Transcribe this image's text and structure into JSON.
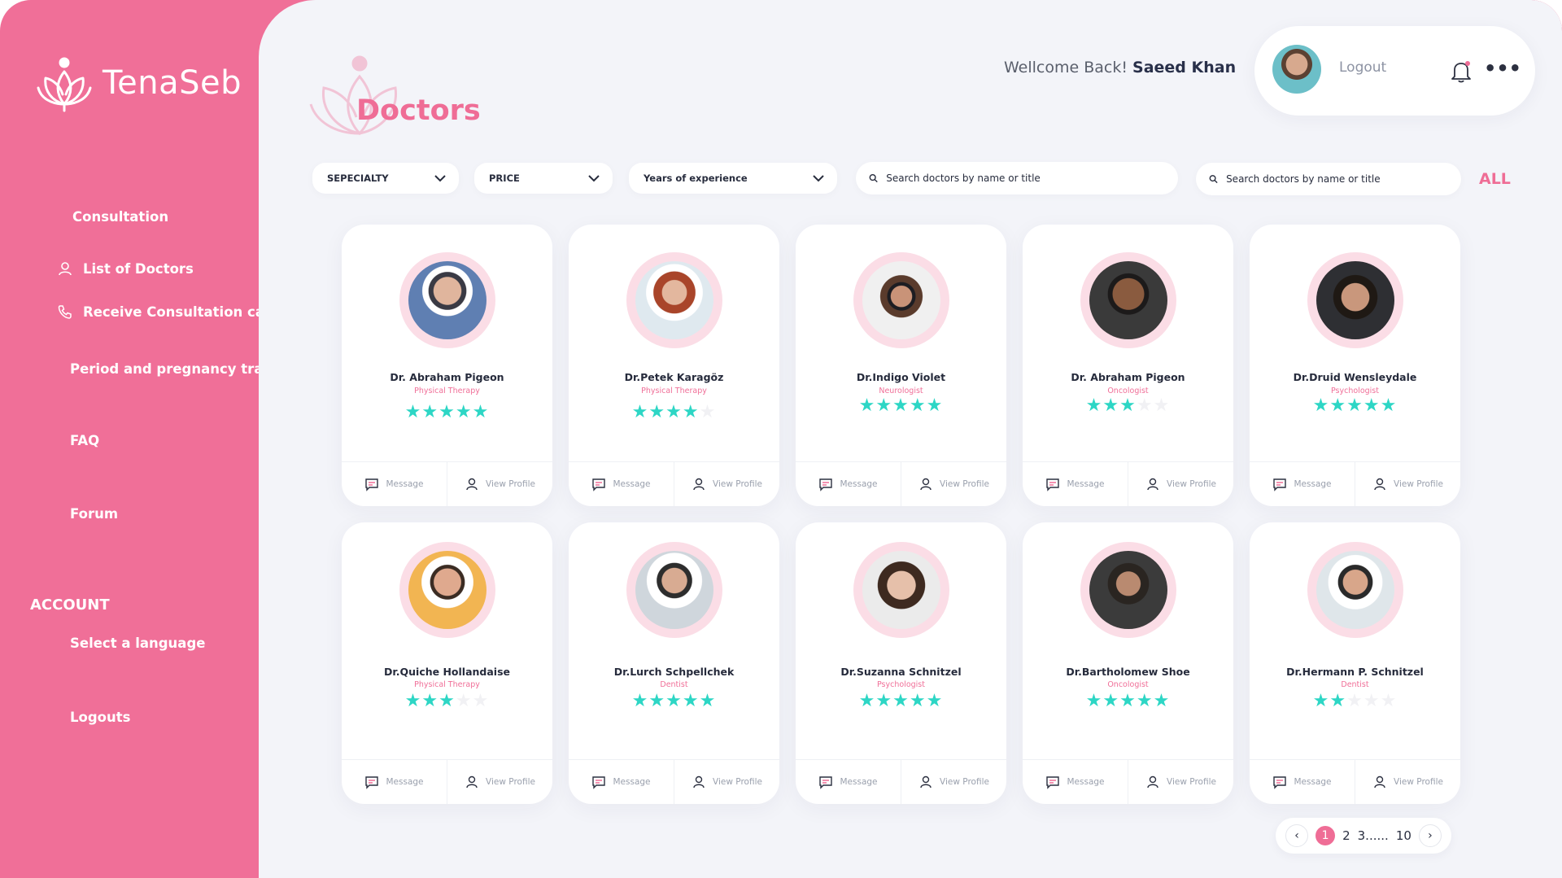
{
  "app": {
    "name": "TenaSeb"
  },
  "sidebar": {
    "consultation": "Consultation",
    "items": [
      {
        "label": "List of Doctors",
        "icon": "user-icon"
      },
      {
        "label": "Receive Consultation call",
        "icon": "phone-icon"
      }
    ],
    "tracker": "Period and pregnancy tracker",
    "faq": "FAQ",
    "forum": "Forum",
    "account_heading": "ACCOUNT",
    "language": "Select a language",
    "logouts": "Logouts"
  },
  "header": {
    "page_title": "Doctors",
    "welcome_prefix": "Wellcome Back!",
    "user_name": "Saeed Khan",
    "logout": "Logout"
  },
  "filters": {
    "specialty": "SEPECIALTY",
    "price": "PRICE",
    "experience": "Years of experience",
    "search1_placeholder": "Search doctors by name or title",
    "search2_placeholder": "Search doctors by name or title",
    "all": "ALL"
  },
  "doctors": [
    {
      "name": "Dr. Abraham Pigeon",
      "specialty": "Physical Therapy",
      "rating": 5
    },
    {
      "name": "Dr.Petek Karagöz",
      "specialty": "Physical Therapy",
      "rating": 4
    },
    {
      "name": "Dr.Indigo Violet",
      "specialty": "Neurologist",
      "rating": 5
    },
    {
      "name": "Dr. Abraham Pigeon",
      "specialty": "Oncologist",
      "rating": 3
    },
    {
      "name": "Dr.Druid Wensleydale",
      "specialty": "Psychologist",
      "rating": 5
    },
    {
      "name": "Dr.Quiche Hollandaise",
      "specialty": "Physical Therapy",
      "rating": 3
    },
    {
      "name": "Dr.Lurch Schpellchek",
      "specialty": "Dentist",
      "rating": 5
    },
    {
      "name": "Dr.Suzanna Schnitzel",
      "specialty": "Psychologist",
      "rating": 5
    },
    {
      "name": "Dr.Bartholomew Shoe",
      "specialty": "Oncologist",
      "rating": 5
    },
    {
      "name": "Dr.Hermann P. Schnitzel",
      "specialty": "Dentist",
      "rating": 2
    }
  ],
  "card_actions": {
    "message": "Message",
    "view_profile": "View Profile"
  },
  "pagination": {
    "pages": [
      "1",
      "2",
      "3......",
      "10"
    ],
    "current": "1"
  },
  "colors": {
    "brand": "#f06f98",
    "accent_stars": "#2dd6c5",
    "main_bg": "#f3f4f9"
  }
}
